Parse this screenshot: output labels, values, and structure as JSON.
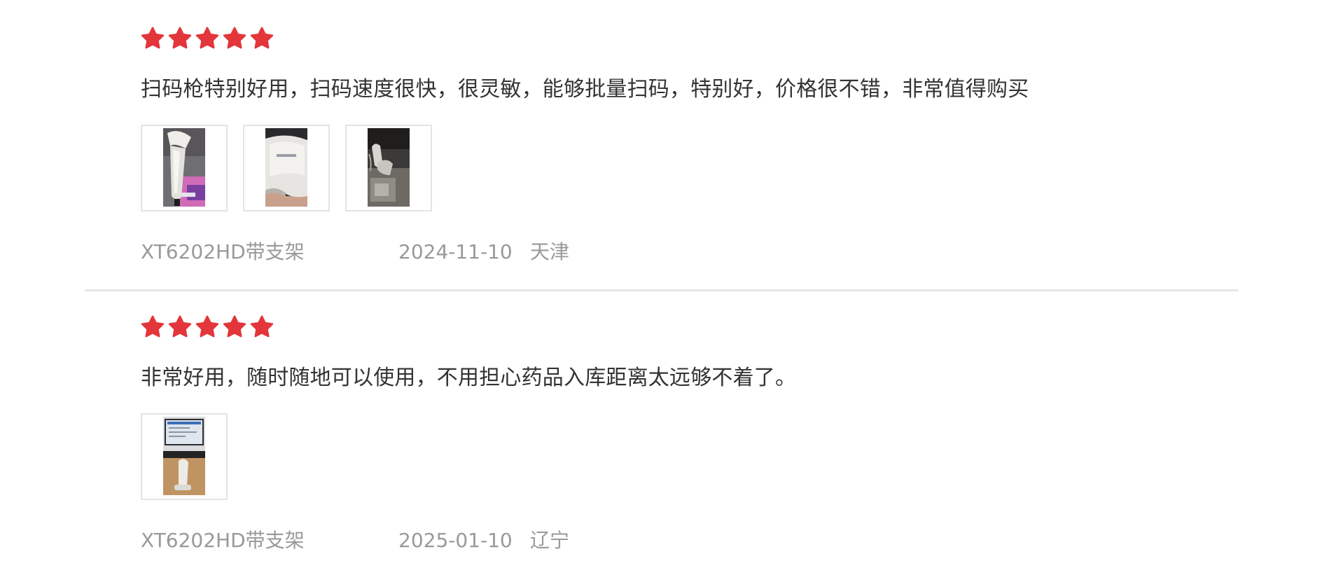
{
  "reviews": [
    {
      "rating": 5,
      "text": "扫码枪特别好用，扫码速度很快，很灵敏，能够批量扫码，特别好，价格很不错，非常值得购买",
      "photos": [
        {
          "description": "handheld scanner with purple label"
        },
        {
          "description": "white scanner head close-up"
        },
        {
          "description": "scanner on stand in dim room"
        }
      ],
      "variant": "XT6202HD带支架",
      "date": "2024-11-10",
      "location": "天津"
    },
    {
      "rating": 5,
      "text": "非常好用，随时随地可以使用，不用担心药品入库距离太远够不着了。",
      "photos": [
        {
          "description": "scanner on desk in front of monitor"
        }
      ],
      "variant": "XT6202HD带支架",
      "date": "2025-01-10",
      "location": "辽宁"
    }
  ],
  "colors": {
    "star": "#e2363b",
    "text": "#333333",
    "meta": "#999999",
    "divider": "#e6e6e6"
  },
  "icons": {
    "star": "star-icon"
  }
}
